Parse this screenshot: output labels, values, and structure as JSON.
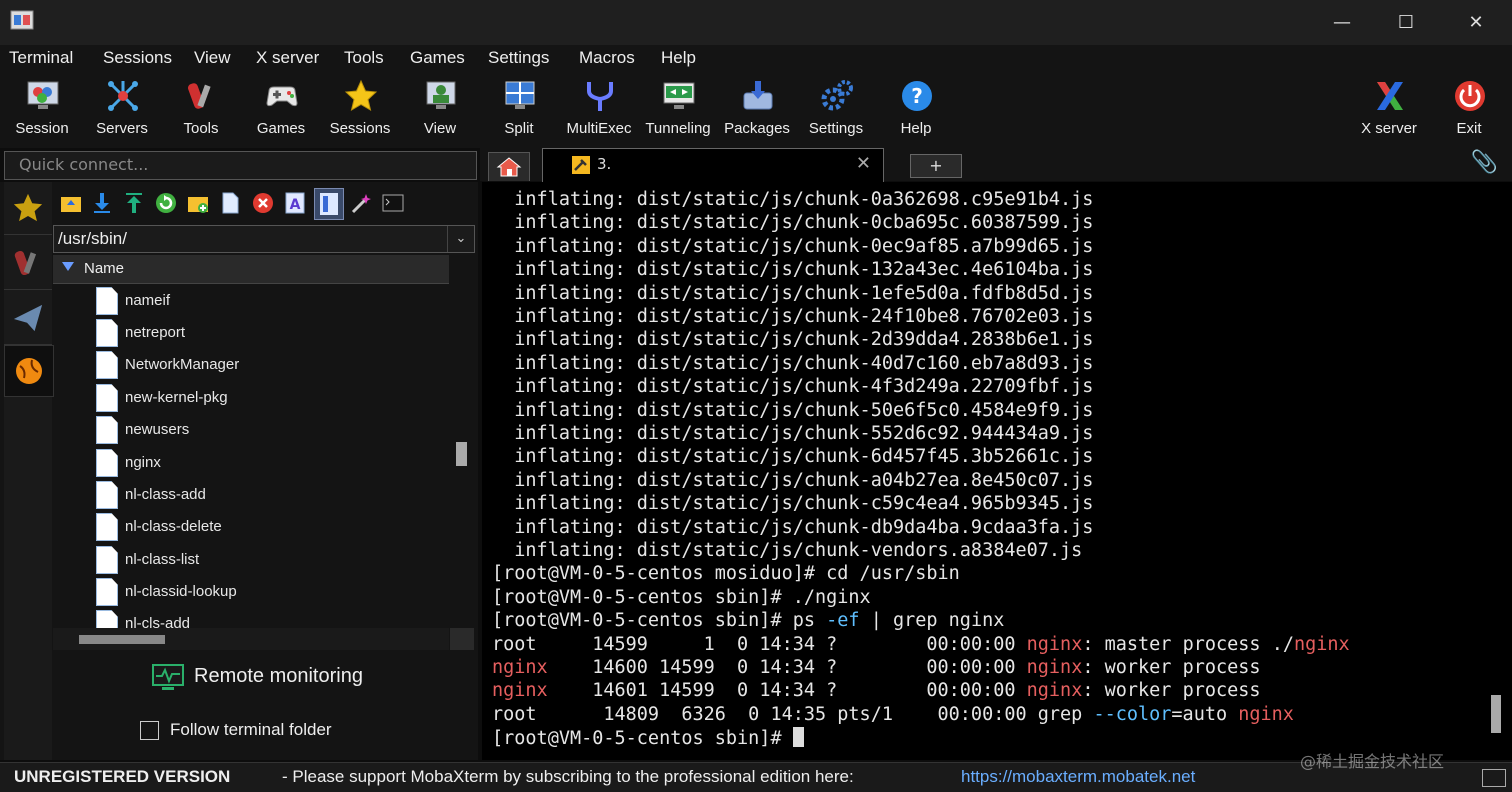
{
  "menu": [
    "Terminal",
    "Sessions",
    "View",
    "X server",
    "Tools",
    "Games",
    "Settings",
    "Macros",
    "Help"
  ],
  "toolbar": [
    {
      "label": "Session",
      "icon": "session-icon"
    },
    {
      "label": "Servers",
      "icon": "servers-icon"
    },
    {
      "label": "Tools",
      "icon": "tools-icon"
    },
    {
      "label": "Games",
      "icon": "games-icon"
    },
    {
      "label": "Sessions",
      "icon": "sessions-star-icon"
    },
    {
      "label": "View",
      "icon": "view-icon"
    },
    {
      "label": "Split",
      "icon": "split-icon"
    },
    {
      "label": "MultiExec",
      "icon": "multiexec-icon"
    },
    {
      "label": "Tunneling",
      "icon": "tunneling-icon"
    },
    {
      "label": "Packages",
      "icon": "packages-icon"
    },
    {
      "label": "Settings",
      "icon": "settings-icon"
    },
    {
      "label": "Help",
      "icon": "help-icon"
    }
  ],
  "toolbar_right": [
    {
      "label": "X server",
      "icon": "xserver-icon"
    },
    {
      "label": "Exit",
      "icon": "exit-icon"
    }
  ],
  "quick_connect": {
    "placeholder": "Quick connect..."
  },
  "tabs": {
    "active_label": "3.",
    "new_tab": "+"
  },
  "sftp": {
    "path": "/usr/sbin/",
    "column": "Name",
    "files": [
      "nameif",
      "netreport",
      "NetworkManager",
      "new-kernel-pkg",
      "newusers",
      "nginx",
      "nl-class-add",
      "nl-class-delete",
      "nl-class-list",
      "nl-classid-lookup",
      "nl-cls-add"
    ],
    "remote_monitoring": "Remote monitoring",
    "follow_folder": "Follow terminal folder"
  },
  "terminal": {
    "inflating": [
      "chunk-0a362698.c95e91b4.js",
      "chunk-0cba695c.60387599.js",
      "chunk-0ec9af85.a7b99d65.js",
      "chunk-132a43ec.4e6104ba.js",
      "chunk-1efe5d0a.fdfb8d5d.js",
      "chunk-24f10be8.76702e03.js",
      "chunk-2d39dda4.2838b6e1.js",
      "chunk-40d7c160.eb7a8d93.js",
      "chunk-4f3d249a.22709fbf.js",
      "chunk-50e6f5c0.4584e9f9.js",
      "chunk-552d6c92.944434a9.js",
      "chunk-6d457f45.3b52661c.js",
      "chunk-a04b27ea.8e450c07.js",
      "chunk-c59c4ea4.965b9345.js",
      "chunk-db9da4ba.9cdaa3fa.js",
      "chunk-vendors.a8384e07.js"
    ],
    "inflating_prefix": "  inflating: dist/static/js/",
    "cmd1": "[root@VM-0-5-centos mosiduo]# cd /usr/sbin",
    "cmd2": "[root@VM-0-5-centos sbin]# ./nginx",
    "cmd3_a": "[root@VM-0-5-centos sbin]# ps ",
    "cmd3_b": "-ef",
    "cmd3_c": " | grep nginx",
    "ps": [
      {
        "user": "root",
        "rest": "     14599     1  0 14:34 ?        00:00:00 ",
        "n": "nginx",
        "tail": ": master process ./",
        "n2": "nginx"
      },
      {
        "user": "nginx",
        "rest": "    14600 14599  0 14:34 ?        00:00:00 ",
        "n": "nginx",
        "tail": ": worker process",
        "n2": ""
      },
      {
        "user": "nginx",
        "rest": "    14601 14599  0 14:34 ?        00:00:00 ",
        "n": "nginx",
        "tail": ": worker process",
        "n2": ""
      }
    ],
    "grep_a": "root      14809  6326  0 14:35 pts/1    00:00:00 grep ",
    "grep_b": "--color",
    "grep_c": "=auto ",
    "grep_d": "nginx",
    "prompt": "[root@VM-0-5-centos sbin]# "
  },
  "status": {
    "unregistered": "UNREGISTERED VERSION",
    "message": " -  Please support MobaXterm by subscribing to the professional edition here:",
    "link": "https://mobaxterm.mobatek.net",
    "watermark": "@稀土掘金技术社区"
  }
}
